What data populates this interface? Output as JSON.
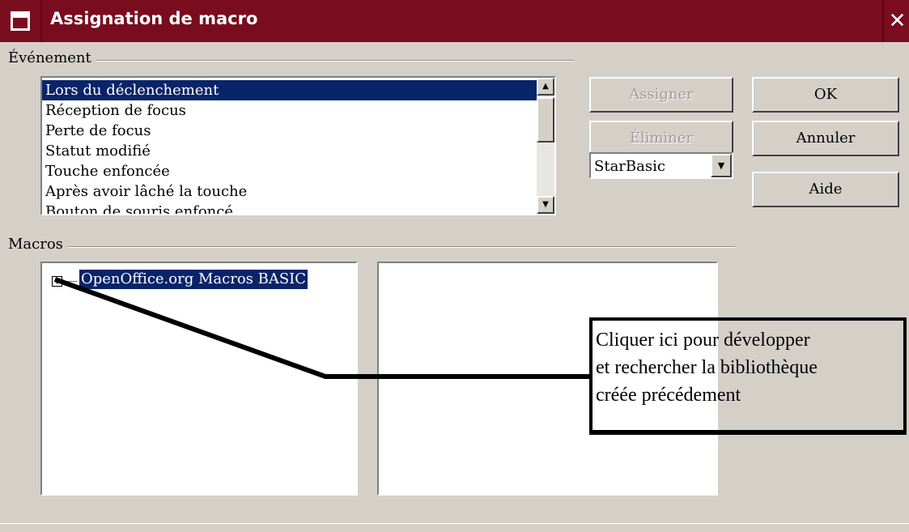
{
  "window": {
    "title": "Assignation de macro",
    "close_glyph": "✕"
  },
  "evenement": {
    "label": "Événement",
    "items": [
      "Lors du déclenchement",
      "Réception de focus",
      "Perte de focus",
      "Statut modifié",
      "Touche enfoncée",
      "Après avoir lâché la touche",
      "Bouton de souris enfoncé"
    ],
    "selected_index": 0
  },
  "buttons": {
    "assigner": "Assigner",
    "eliminer": "Éliminer",
    "ok": "OK",
    "annuler": "Annuler",
    "aide": "Aide"
  },
  "language_select": {
    "value": "StarBasic"
  },
  "macros": {
    "label": "Macros",
    "tree_root": "OpenOffice.org Macros BASIC"
  },
  "callout": {
    "line1": " Cliquer ici pour développer",
    "line2": "et rechercher la bibliothèque",
    "line3": "créée précédement"
  },
  "icons": {
    "window": "window-menu-icon",
    "close": "close-icon",
    "expand": "expand-plus-icon",
    "scroll_up": "scroll-up-icon",
    "scroll_down": "scroll-down-icon",
    "dropdown": "chevron-down-icon"
  },
  "colors": {
    "title_bar": "#7a0c1f",
    "selection": "#0a246a",
    "dialog_bg": "#d4d0c8"
  }
}
